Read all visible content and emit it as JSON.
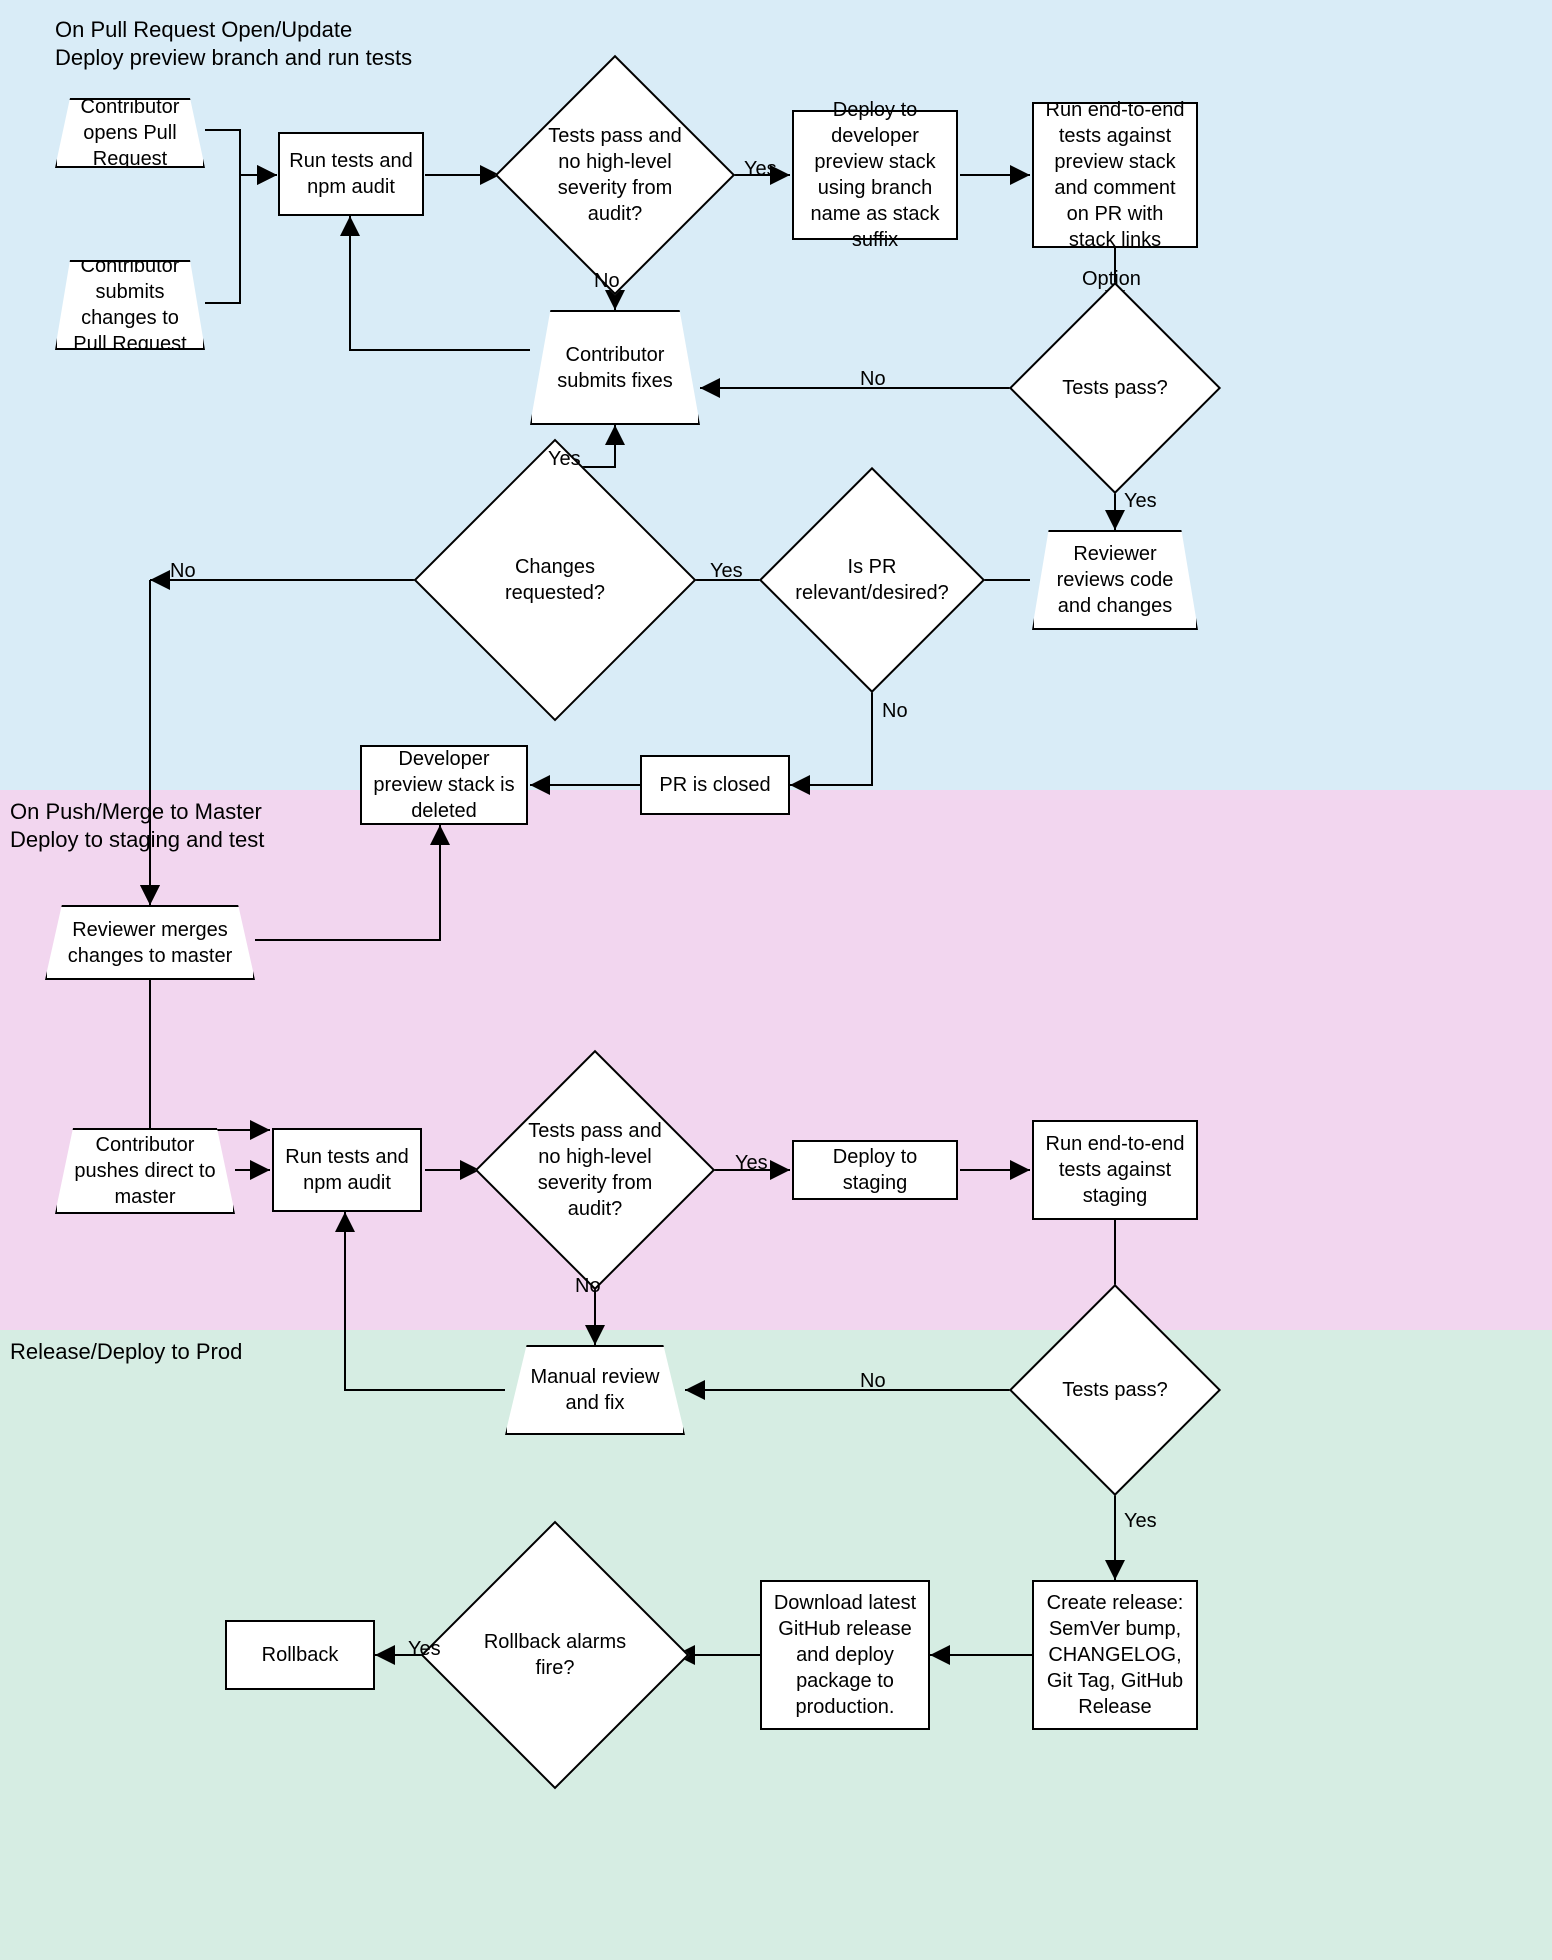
{
  "sections": {
    "s1_l1": "On Pull Request Open/Update",
    "s1_l2": "Deploy preview branch and run tests",
    "s2_l1": "On Push/Merge to Master",
    "s2_l2": "Deploy to staging and test",
    "s3_l1": "Release/Deploy to Prod"
  },
  "nodes": {
    "open_pr": "Contributor opens Pull Request",
    "submit_changes": "Contributor submits changes to Pull Request",
    "run_tests1": "Run tests and npm audit",
    "tests_audit1": "Tests pass and no high-level severity from audit?",
    "deploy_preview": "Deploy to developer preview stack using branch name as stack suffix",
    "run_e2e_preview": "Run end-to-end tests against preview stack and comment on PR with stack links",
    "submits_fixes": "Contributor submits fixes",
    "tests_pass1": "Tests pass?",
    "reviewer_reviews": "Reviewer reviews code and changes",
    "pr_relevant": "Is PR relevant/desired?",
    "changes_requested": "Changes requested?",
    "preview_deleted": "Developer preview stack is deleted",
    "pr_closed": "PR is closed",
    "reviewer_merges": "Reviewer merges changes to master",
    "push_master": "Contributor pushes direct to master",
    "run_tests2": "Run tests and npm audit",
    "tests_audit2": "Tests pass and no high-level severity from audit?",
    "deploy_staging": "Deploy to staging",
    "run_e2e_staging": "Run end-to-end tests against staging",
    "manual_review": "Manual review and fix",
    "tests_pass2": "Tests pass?",
    "create_release": "Create release: SemVer bump, CHANGELOG, Git Tag, GitHub Release",
    "download_deploy": "Download latest GitHub release and deploy package to production.",
    "rollback_alarms": "Rollback alarms fire?",
    "rollback": "Rollback"
  },
  "edge_labels": {
    "yes": "Yes",
    "no": "No",
    "option": "Option"
  }
}
